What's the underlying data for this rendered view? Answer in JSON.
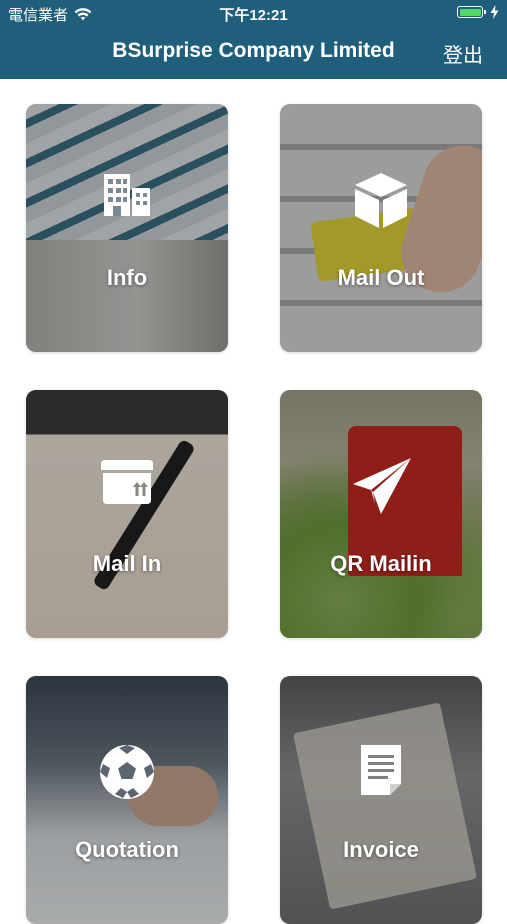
{
  "status_bar": {
    "carrier": "電信業者",
    "time": "下午12:21",
    "wifi_icon": "wifi-icon",
    "battery_icon": "battery-icon",
    "charging_icon": "charging-bolt-icon"
  },
  "nav": {
    "title": "BSurprise Company Limited",
    "logout_label": "登出"
  },
  "tiles": [
    {
      "label": "Info",
      "icon": "building-icon"
    },
    {
      "label": "Mail Out",
      "icon": "box-icon"
    },
    {
      "label": "Mail In",
      "icon": "package-icon"
    },
    {
      "label": "QR Mailin",
      "icon": "paper-plane-icon"
    },
    {
      "label": "Quotation",
      "icon": "soccer-ball-icon"
    },
    {
      "label": "Invoice",
      "icon": "document-icon"
    }
  ],
  "colors": {
    "nav_background": "#1f5f7c",
    "battery_fill": "#4cd964",
    "page_background": "#ffffff"
  }
}
